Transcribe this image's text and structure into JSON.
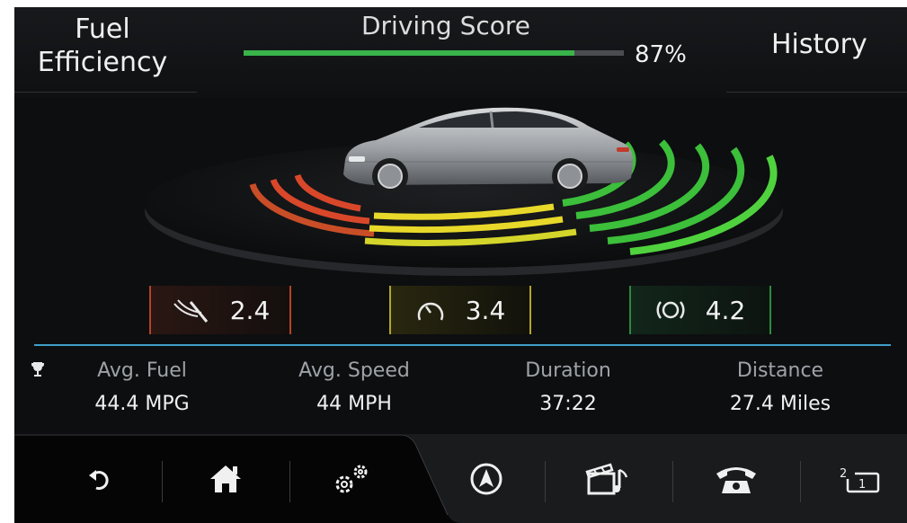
{
  "header": {
    "title_line1": "Fuel",
    "title_line2": "Efficiency",
    "driving_score_label": "Driving Score",
    "driving_score_percent": "87%",
    "driving_score_value": 0.87,
    "history_label": "History"
  },
  "scores": {
    "braking": {
      "icon": "braking-icon",
      "value": "2.4",
      "color": "#b44226"
    },
    "speed": {
      "icon": "speedometer-icon",
      "value": "3.4",
      "color": "#b5a527"
    },
    "gear": {
      "icon": "gear-shift-icon",
      "value": "4.2",
      "color": "#2e8a3e"
    }
  },
  "stats": {
    "avg_fuel": {
      "label": "Avg. Fuel",
      "value": "44.4 MPG"
    },
    "avg_speed": {
      "label": "Avg. Speed",
      "value": "44 MPH"
    },
    "duration": {
      "label": "Duration",
      "value": "37:22"
    },
    "distance": {
      "label": "Distance",
      "value": "27.4 Miles"
    }
  },
  "nav": [
    {
      "icon": "back-icon"
    },
    {
      "icon": "home-icon"
    },
    {
      "icon": "settings-gears-icon"
    },
    {
      "icon": "navigation-icon"
    },
    {
      "icon": "media-icon"
    },
    {
      "icon": "phone-icon"
    },
    {
      "icon": "screen-switch-icon"
    }
  ],
  "colors": {
    "accent_blue": "#3fa0c8",
    "score_green": "#39b34a",
    "arc_red": "#d9472a",
    "arc_yellow": "#e8d82a",
    "arc_green": "#3cbf3a"
  }
}
